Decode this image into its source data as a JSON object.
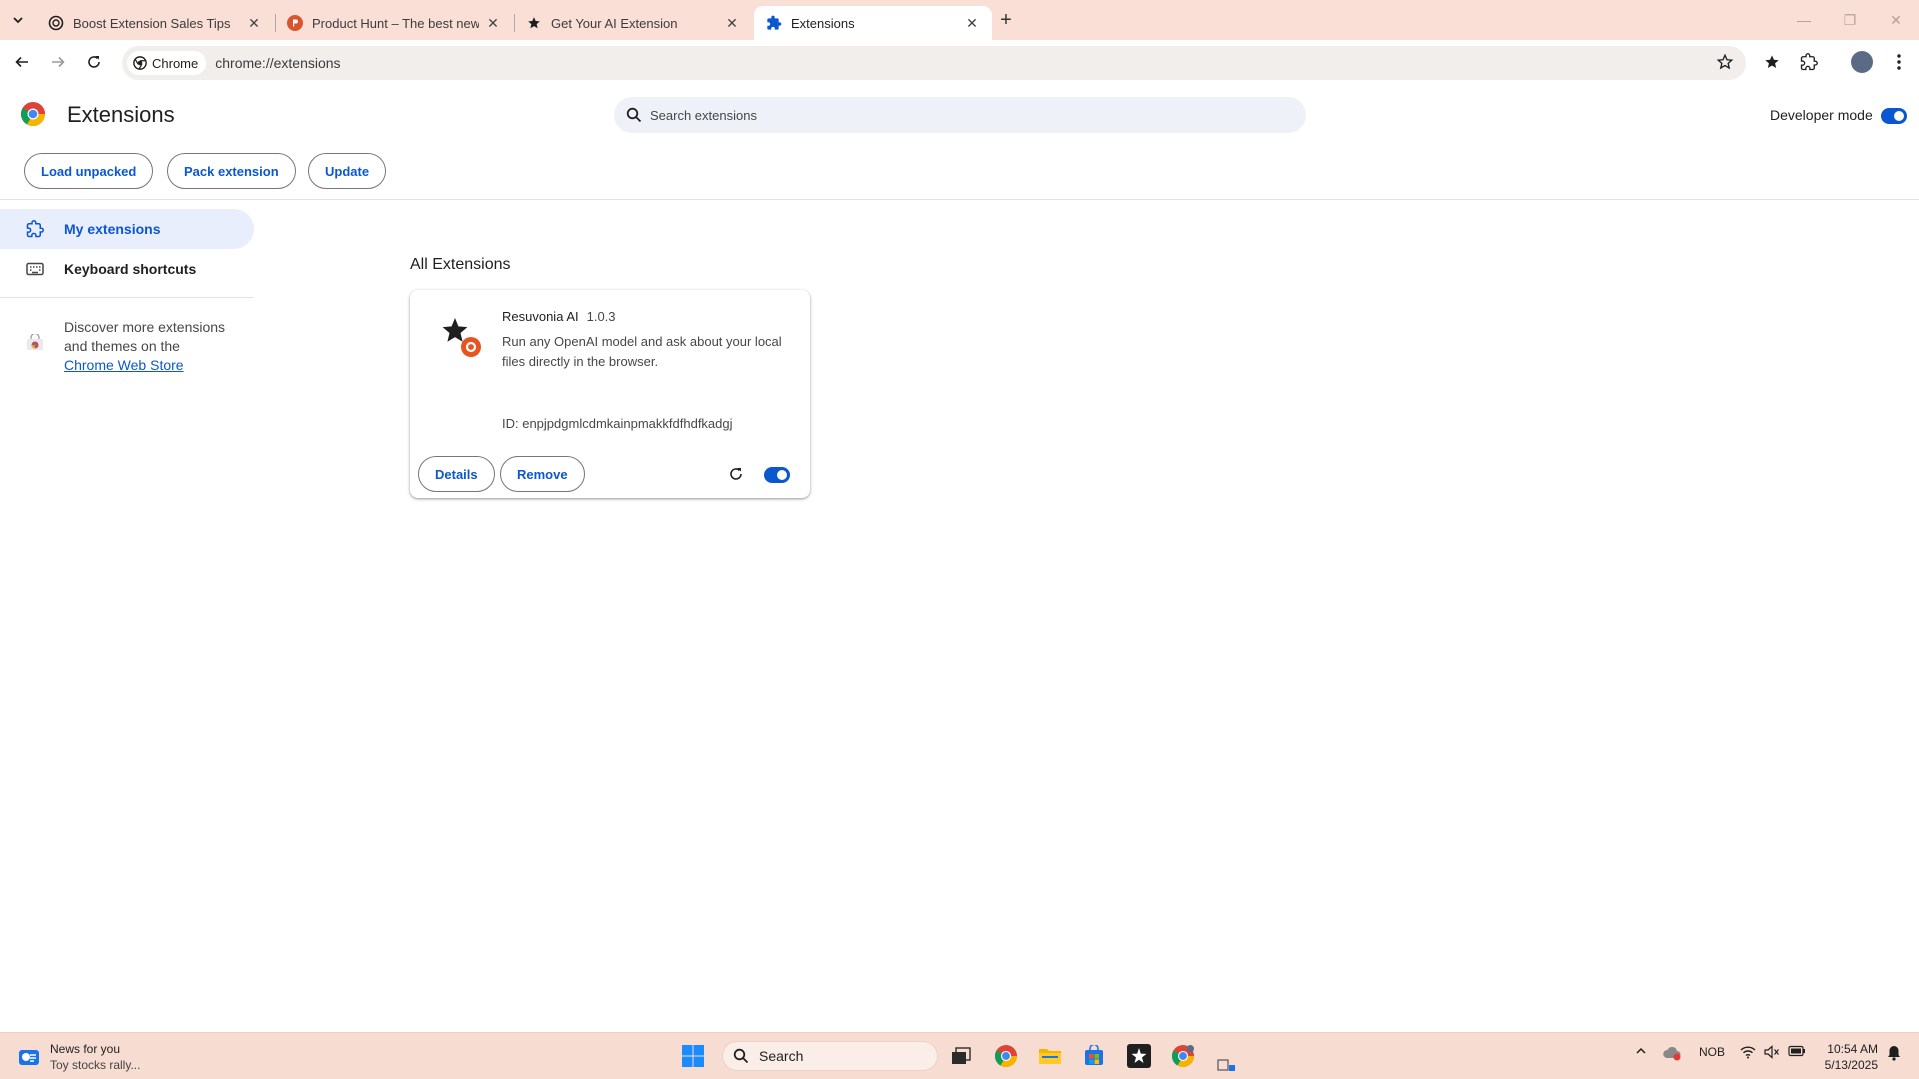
{
  "tabs": [
    {
      "title": "Boost Extension Sales Tips",
      "active": false
    },
    {
      "title": "Product Hunt – The best new p",
      "active": false
    },
    {
      "title": "Get Your AI Extension",
      "active": false
    },
    {
      "title": "Extensions",
      "active": true
    }
  ],
  "toolbar": {
    "chip_label": "Chrome",
    "url": "chrome://extensions"
  },
  "header": {
    "title": "Extensions",
    "search_placeholder": "Search extensions",
    "developer_mode_label": "Developer mode",
    "developer_mode_on": true,
    "buttons": {
      "load_unpacked": "Load unpacked",
      "pack_extension": "Pack extension",
      "update": "Update"
    }
  },
  "sidebar": {
    "items": [
      {
        "label": "My extensions",
        "selected": true
      },
      {
        "label": "Keyboard shortcuts",
        "selected": false
      }
    ],
    "discover_text": "Discover more extensions and themes on the",
    "discover_link": "Chrome Web Store"
  },
  "main": {
    "section_title": "All Extensions",
    "extension": {
      "name": "Resuvonia AI",
      "version": "1.0.3",
      "description": "Run any OpenAI model and ask about your local files directly in the browser.",
      "id_text": "ID: enpjpdgmlcdmkainpmakkfdfhdfkadgj",
      "details_label": "Details",
      "remove_label": "Remove",
      "enabled": true
    }
  },
  "taskbar": {
    "news_title": "News for you",
    "news_sub": "Toy stocks rally...",
    "search_label": "Search",
    "language": "NOB",
    "time": "10:54 AM",
    "date": "5/13/2025"
  },
  "colors": {
    "accent": "#0b57d0",
    "tabstrip": "#f9dfd5",
    "taskbar": "#f7dcd1"
  }
}
